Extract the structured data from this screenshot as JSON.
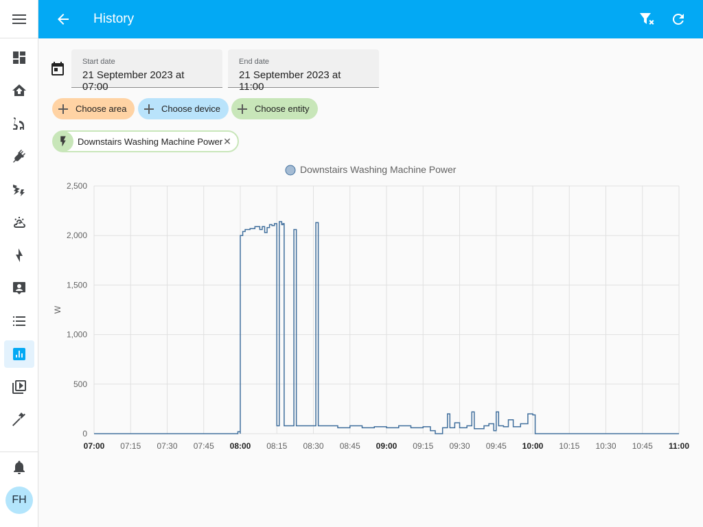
{
  "header": {
    "title": "History"
  },
  "sidebar": {
    "items": [
      {
        "name": "overview",
        "icon": "dashboard-icon"
      },
      {
        "name": "home",
        "icon": "home-icon"
      },
      {
        "name": "vacuum",
        "icon": "robot-vacuum-icon"
      },
      {
        "name": "plugs",
        "icon": "power-plug-icon"
      },
      {
        "name": "energy-flash",
        "icon": "weather-lightning-icon"
      },
      {
        "name": "weather",
        "icon": "weather-partly-cloudy-icon"
      },
      {
        "name": "energy",
        "icon": "lightning-bolt-icon"
      },
      {
        "name": "logbook",
        "icon": "account-box-icon"
      },
      {
        "name": "todo",
        "icon": "format-list-icon"
      },
      {
        "name": "history",
        "icon": "chart-box-icon",
        "active": true
      },
      {
        "name": "media",
        "icon": "play-box-multiple-icon"
      },
      {
        "name": "developer-tools",
        "icon": "hammer-icon"
      }
    ],
    "user_initials": "FH"
  },
  "dates": {
    "start_label": "Start date",
    "start_value": "21 September 2023 at 07:00",
    "end_label": "End date",
    "end_value": "21 September 2023 at 11:00"
  },
  "pickers": {
    "area": "Choose area",
    "device": "Choose device",
    "entity": "Choose entity"
  },
  "colors": {
    "accent": "#03a9f4",
    "area_pill": "#ffd3a4",
    "device_pill": "#b9e3fb",
    "entity_pill": "#c8e6b9",
    "series": "#3f6e9c"
  },
  "selected_entity": {
    "label": "Downstairs Washing Machine Power",
    "icon": "flash-icon"
  },
  "chart_data": {
    "type": "line",
    "title": "",
    "xlabel": "",
    "ylabel": "W",
    "ylim": [
      0,
      2500
    ],
    "xlim": [
      "07:00",
      "11:00"
    ],
    "y_ticks": [
      "0",
      "500",
      "1,000",
      "1,500",
      "2,000",
      "2,500"
    ],
    "y_tick_values": [
      0,
      500,
      1000,
      1500,
      2000,
      2500
    ],
    "x_ticks": [
      "07:00",
      "07:15",
      "07:30",
      "07:45",
      "08:00",
      "08:15",
      "08:30",
      "08:45",
      "09:00",
      "09:15",
      "09:30",
      "09:45",
      "10:00",
      "10:15",
      "10:30",
      "10:45",
      "11:00"
    ],
    "x_ticks_bold": [
      "07:00",
      "08:00",
      "09:00",
      "10:00",
      "11:00"
    ],
    "legend": "top-center",
    "grid": true,
    "series": [
      {
        "name": "Downstairs Washing Machine Power",
        "step": true,
        "points": [
          [
            "07:00",
            0
          ],
          [
            "07:58",
            0
          ],
          [
            "07:59",
            20
          ],
          [
            "08:00",
            0
          ],
          [
            "08:00",
            2000
          ],
          [
            "08:01",
            2040
          ],
          [
            "08:02",
            2060
          ],
          [
            "08:04",
            2070
          ],
          [
            "08:06",
            2090
          ],
          [
            "08:08",
            2060
          ],
          [
            "08:09",
            2090
          ],
          [
            "08:10",
            2030
          ],
          [
            "08:11",
            2080
          ],
          [
            "08:12",
            2110
          ],
          [
            "08:13",
            2100
          ],
          [
            "08:14",
            2120
          ],
          [
            "08:15",
            80
          ],
          [
            "08:16",
            2140
          ],
          [
            "08:17",
            2110
          ],
          [
            "08:17.5",
            2120
          ],
          [
            "08:18",
            80
          ],
          [
            "08:22",
            2060
          ],
          [
            "08:23",
            80
          ],
          [
            "08:24",
            80
          ],
          [
            "08:30",
            80
          ],
          [
            "08:31",
            2130
          ],
          [
            "08:32",
            80
          ],
          [
            "08:35",
            80
          ],
          [
            "08:40",
            60
          ],
          [
            "08:45",
            80
          ],
          [
            "08:50",
            60
          ],
          [
            "08:55",
            70
          ],
          [
            "09:00",
            60
          ],
          [
            "09:05",
            80
          ],
          [
            "09:10",
            60
          ],
          [
            "09:15",
            70
          ],
          [
            "09:18",
            30
          ],
          [
            "09:20",
            0
          ],
          [
            "09:23",
            60
          ],
          [
            "09:25",
            200
          ],
          [
            "09:26",
            60
          ],
          [
            "09:28",
            110
          ],
          [
            "09:30",
            60
          ],
          [
            "09:33",
            80
          ],
          [
            "09:35",
            220
          ],
          [
            "09:36",
            50
          ],
          [
            "09:40",
            80
          ],
          [
            "09:42",
            100
          ],
          [
            "09:44",
            30
          ],
          [
            "09:45",
            220
          ],
          [
            "09:46",
            80
          ],
          [
            "09:48",
            70
          ],
          [
            "09:50",
            140
          ],
          [
            "09:52",
            70
          ],
          [
            "09:55",
            100
          ],
          [
            "09:58",
            200
          ],
          [
            "10:00",
            190
          ],
          [
            "10:01",
            0
          ],
          [
            "10:05",
            0
          ],
          [
            "11:00",
            0
          ]
        ]
      }
    ]
  }
}
